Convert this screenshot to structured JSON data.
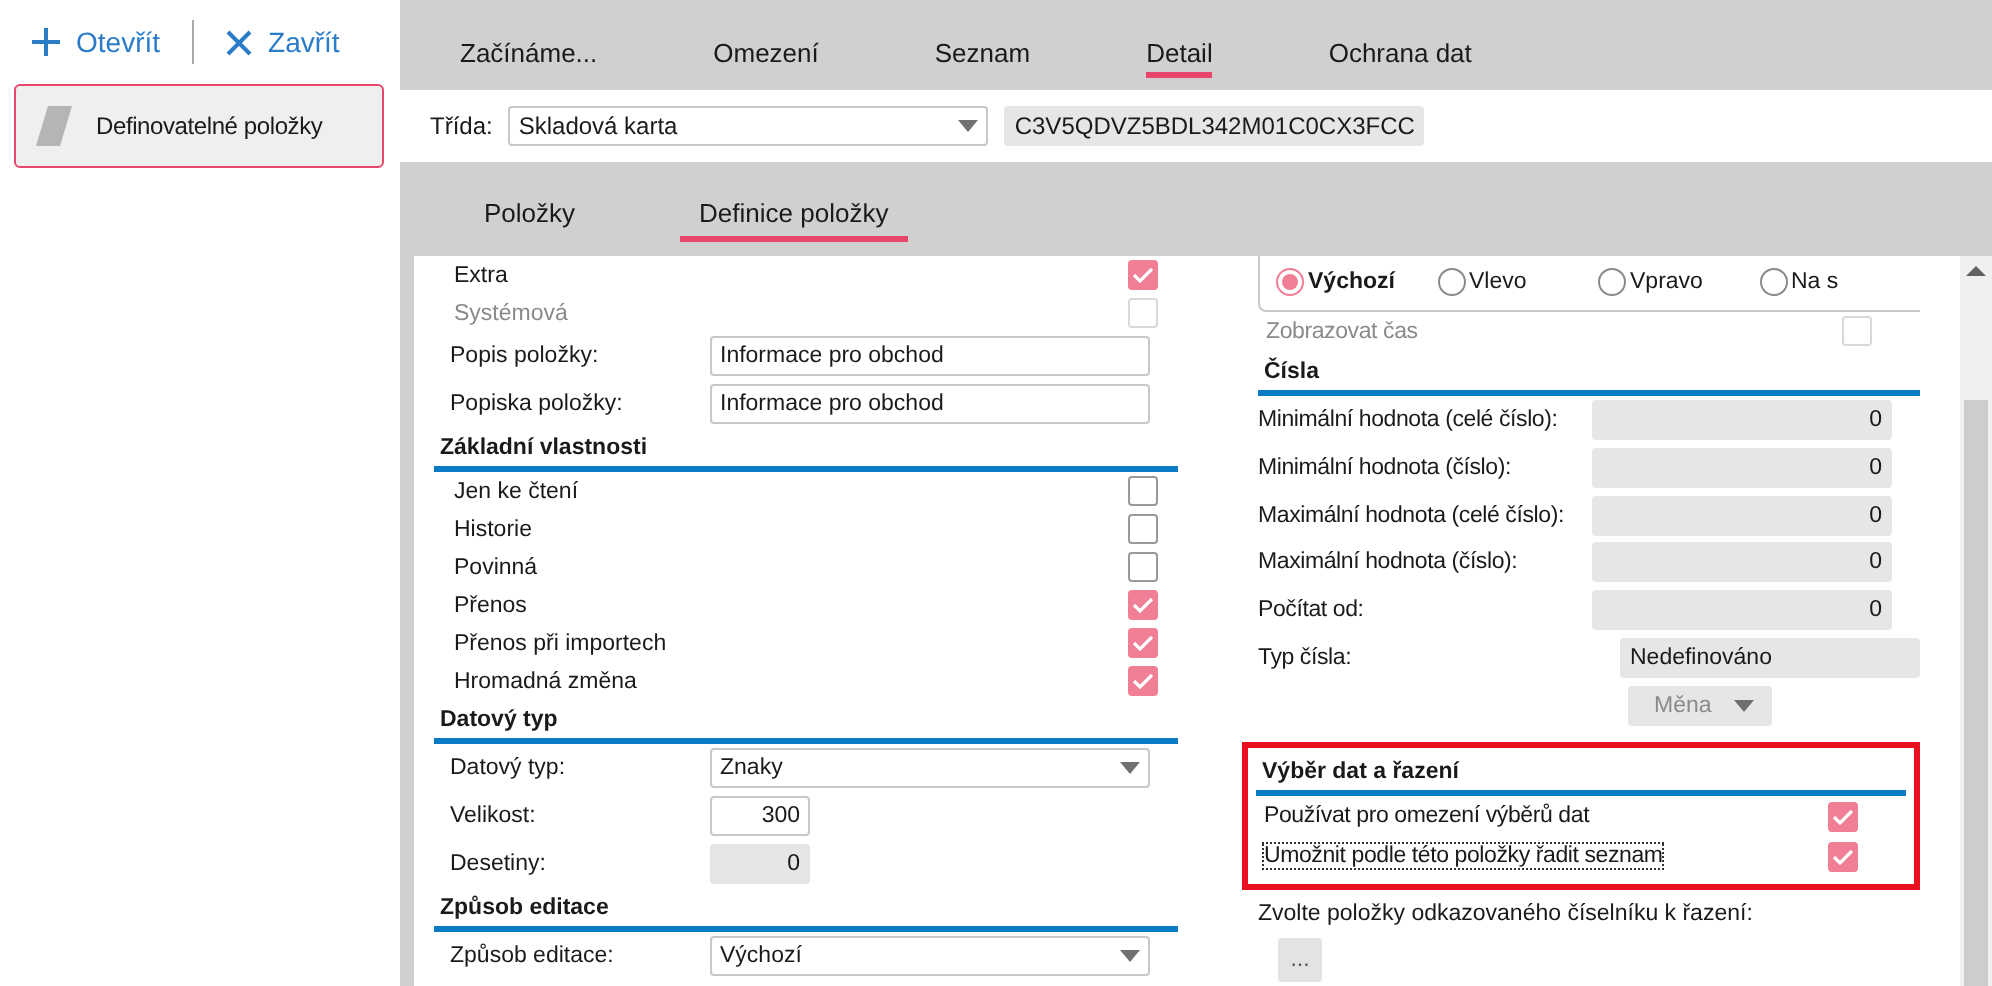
{
  "toolbar": {
    "buttons": [
      {
        "label": "Otevřít",
        "kind": "add"
      },
      {
        "label": "Zavřít",
        "kind": "close"
      }
    ]
  },
  "sidebar": {
    "items": [
      {
        "label": "Definovatelné položky",
        "selected": true
      }
    ]
  },
  "tabs": [
    {
      "label": "Začínáme...",
      "selected": false
    },
    {
      "label": "Omezení",
      "selected": false
    },
    {
      "label": "Seznam",
      "selected": false
    },
    {
      "label": "Detail",
      "selected": true
    },
    {
      "label": "Ochrana dat",
      "selected": false
    }
  ],
  "class_row": {
    "label": "Třída:",
    "value": "Skladová karta",
    "code": "C3V5QDVZ5BDL342M01C0CX3FCC"
  },
  "subtabs": [
    {
      "label": "Položky",
      "selected": false
    },
    {
      "label": "Definice položky",
      "selected": true
    }
  ],
  "left_panel": {
    "rows": [
      {
        "kind": "checkbox",
        "label": "Extra",
        "checked": true,
        "disabled": false
      },
      {
        "kind": "checkbox",
        "label": "Systémová",
        "checked": false,
        "disabled": true
      },
      {
        "kind": "text",
        "label": "Popis položky:",
        "value": "Informace pro obchod"
      },
      {
        "kind": "text",
        "label": "Popiska položky:",
        "value": "Informace pro obchod"
      },
      {
        "kind": "section",
        "label": "Základní vlastnosti"
      },
      {
        "kind": "checkbox",
        "label": "Jen ke čtení",
        "checked": false,
        "disabled": false
      },
      {
        "kind": "checkbox",
        "label": "Historie",
        "checked": false,
        "disabled": false
      },
      {
        "kind": "checkbox",
        "label": "Povinná",
        "checked": false,
        "disabled": false
      },
      {
        "kind": "checkbox",
        "label": "Přenos",
        "checked": true,
        "disabled": false
      },
      {
        "kind": "checkbox",
        "label": "Přenos při importech",
        "checked": true,
        "disabled": false
      },
      {
        "kind": "checkbox",
        "label": "Hromadná změna",
        "checked": true,
        "disabled": false
      },
      {
        "kind": "section",
        "label": "Datový typ"
      },
      {
        "kind": "select",
        "label": "Datový typ:",
        "value": "Znaky"
      },
      {
        "kind": "number",
        "label": "Velikost:",
        "value": "300",
        "disabled": false
      },
      {
        "kind": "number",
        "label": "Desetiny:",
        "value": "0",
        "disabled": true
      },
      {
        "kind": "section",
        "label": "Způsob editace"
      },
      {
        "kind": "select",
        "label": "Způsob editace:",
        "value": "Výchozí"
      }
    ]
  },
  "right_panel": {
    "rows": [
      {
        "kind": "radios",
        "options": [
          {
            "label": "Výchozí",
            "selected": true
          },
          {
            "label": "Vlevo",
            "selected": false
          },
          {
            "label": "Vpravo",
            "selected": false
          },
          {
            "label": "Na s",
            "selected": false
          }
        ]
      },
      {
        "kind": "checkbox",
        "label": "Zobrazovat čas",
        "checked": false,
        "disabled": true
      },
      {
        "kind": "section",
        "label": "Čísla"
      },
      {
        "kind": "wide-number",
        "label": "Minimální hodnota (celé číslo):",
        "value": "0",
        "disabled": true
      },
      {
        "kind": "wide-number",
        "label": "Minimální hodnota (číslo):",
        "value": "0",
        "disabled": true
      },
      {
        "kind": "wide-number",
        "label": "Maximální hodnota (celé číslo):",
        "value": "0",
        "disabled": true
      },
      {
        "kind": "wide-number",
        "label": "Maximální hodnota (číslo):",
        "value": "0",
        "disabled": true
      },
      {
        "kind": "wide-number",
        "label": "Počítat od:",
        "value": "0",
        "disabled": true
      },
      {
        "kind": "value",
        "label": "Typ čísla:",
        "value": "Nedefinováno"
      },
      {
        "kind": "dropdown-button",
        "label": "Měna",
        "disabled": true
      },
      {
        "kind": "group",
        "highlighted": true,
        "rows": [
          {
            "kind": "section",
            "label": "Výběr dat a řazení"
          },
          {
            "kind": "checkbox",
            "label": "Používat pro omezení výběrů dat",
            "checked": true,
            "disabled": false,
            "focused": false
          },
          {
            "kind": "checkbox",
            "label": "Umožnit podle této položky řadit seznam",
            "checked": true,
            "disabled": false,
            "focused": true
          }
        ]
      },
      {
        "kind": "note",
        "label": "Zvolte položky odkazovaného číselníku k řazení:"
      },
      {
        "kind": "button",
        "label": "..."
      }
    ]
  }
}
